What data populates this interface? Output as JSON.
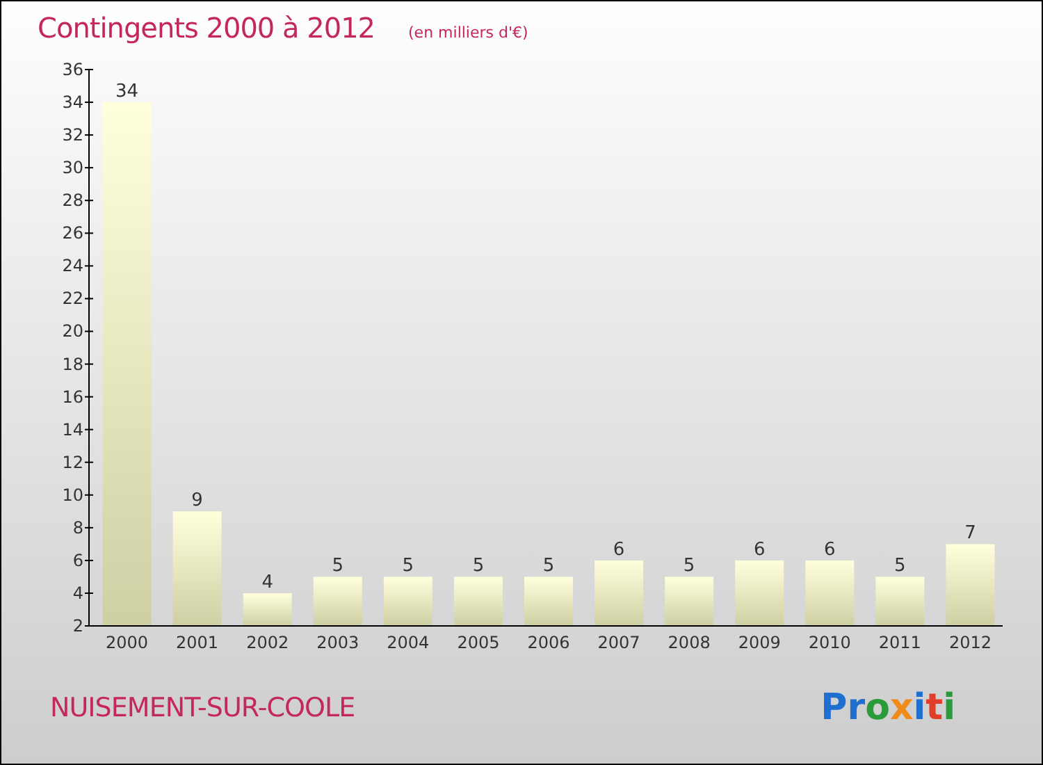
{
  "header": {
    "title": "Contingents 2000 à 2012",
    "unit": "(en milliers d'€)"
  },
  "chart_data": {
    "type": "bar",
    "categories": [
      "2000",
      "2001",
      "2002",
      "2003",
      "2004",
      "2005",
      "2006",
      "2007",
      "2008",
      "2009",
      "2010",
      "2011",
      "2012"
    ],
    "values": [
      34,
      9,
      4,
      5,
      5,
      5,
      5,
      6,
      5,
      6,
      6,
      5,
      7
    ],
    "value_labels": [
      "34",
      "9",
      "4",
      "5",
      "5",
      "5",
      "5",
      "6",
      "5",
      "6",
      "6",
      "5",
      "7"
    ],
    "ylim": [
      2,
      36
    ],
    "yticks": [
      2,
      4,
      6,
      8,
      10,
      12,
      14,
      16,
      18,
      20,
      22,
      24,
      26,
      28,
      30,
      32,
      34,
      36
    ]
  },
  "footer": {
    "place": "NUISEMENT-SUR-COOLE",
    "logo": "Proxiti"
  }
}
